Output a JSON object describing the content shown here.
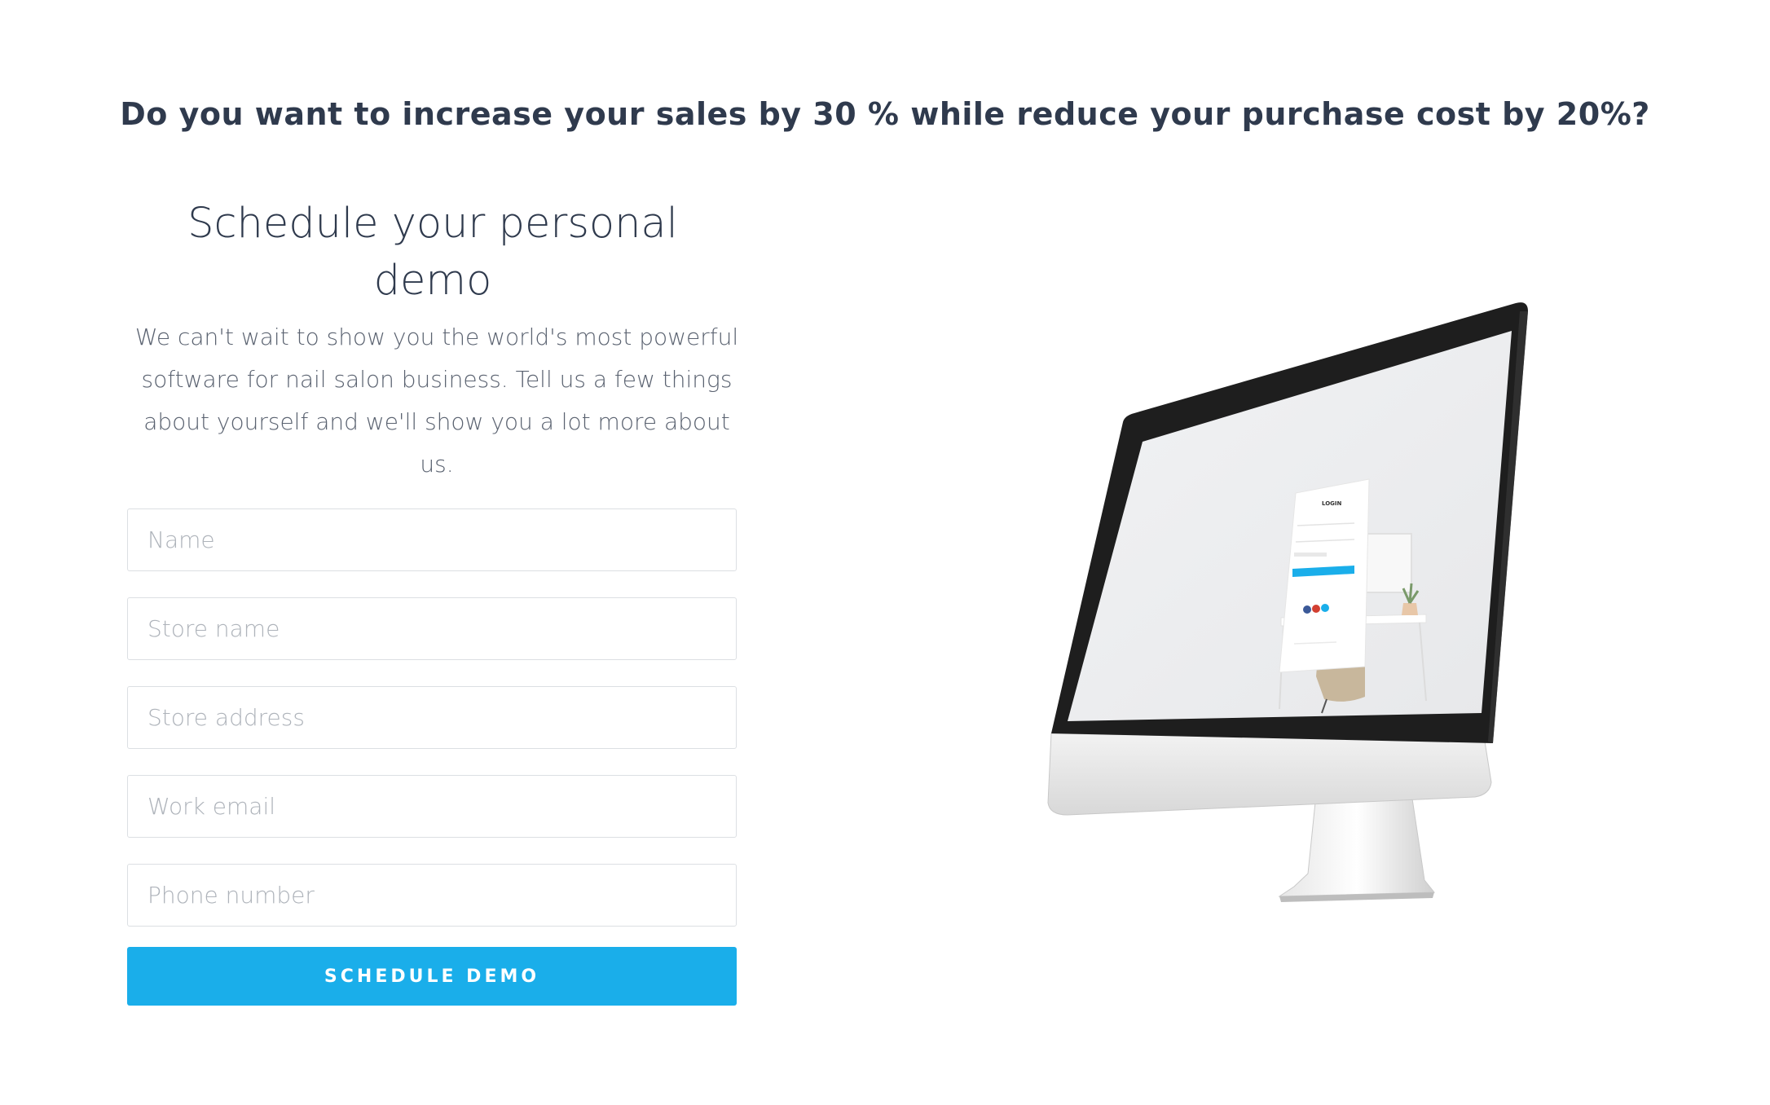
{
  "headline": "Do you want to increase your sales by 30 % while reduce your purchase cost by 20%?",
  "demo": {
    "title": "Schedule your personal demo",
    "description": "We can't wait to show you the world's most powerful software for nail salon business. Tell us a few things about yourself and we'll show you a lot more about us."
  },
  "form": {
    "fields": [
      {
        "placeholder": "Name",
        "value": ""
      },
      {
        "placeholder": "Store name",
        "value": ""
      },
      {
        "placeholder": "Store address",
        "value": ""
      },
      {
        "placeholder": "Work email",
        "value": ""
      },
      {
        "placeholder": "Phone number",
        "value": ""
      }
    ],
    "submit_label": "SCHEDULE DEMO"
  },
  "illustration": {
    "screen_login_title": "LOGIN",
    "icons": [
      "monitor-illustration",
      "social-login-icons"
    ]
  },
  "colors": {
    "accent": "#1aaeea",
    "heading": "#2f3a4d",
    "body_text": "#5a6270",
    "border": "#dcdfe3",
    "placeholder": "#aeb3ba"
  }
}
